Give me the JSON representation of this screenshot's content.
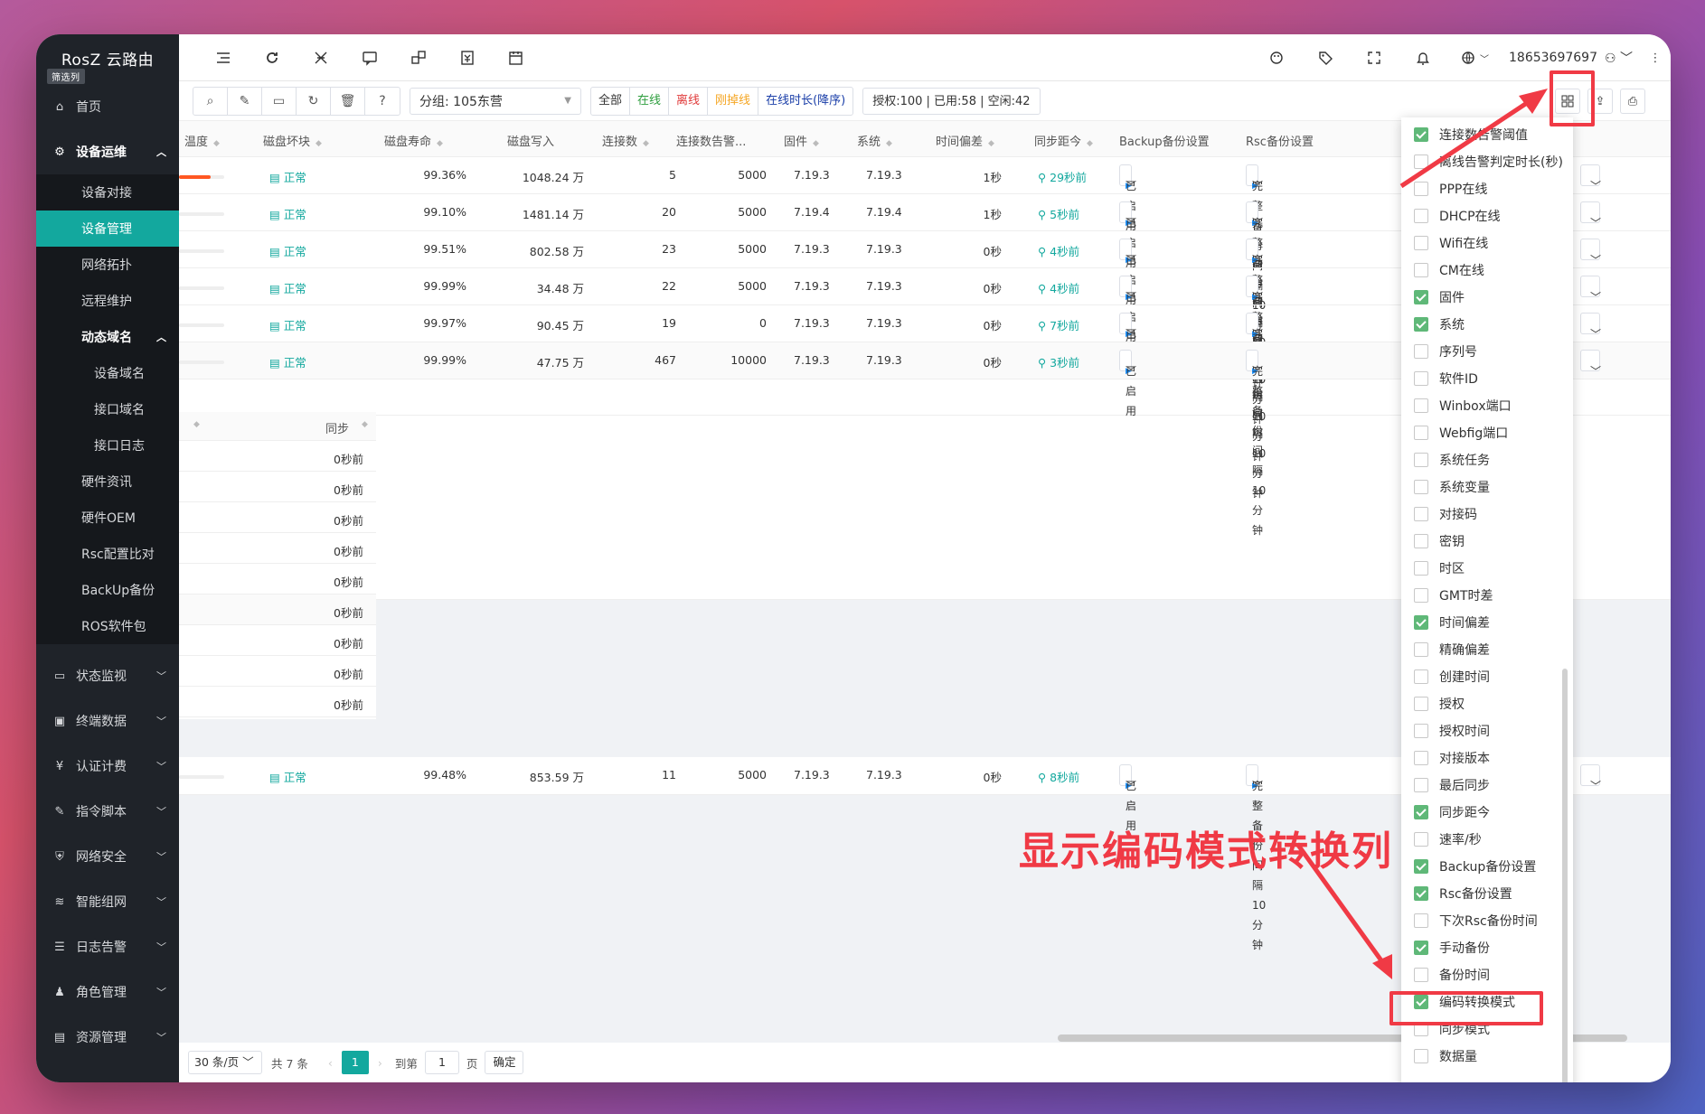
{
  "brand": {
    "name": "RosZ 云路由",
    "tag": "筛选列"
  },
  "nav": {
    "home": "首页",
    "ops": "设备运维",
    "ops_items": [
      "设备对接",
      "设备管理",
      "网络拓扑",
      "远程维护"
    ],
    "ddns": "动态域名",
    "ddns_items": [
      "设备域名",
      "接口域名",
      "接口日志"
    ],
    "more_items": [
      "硬件资讯",
      "硬件OEM",
      "Rsc配置比对",
      "BackUp备份",
      "ROS软件包"
    ],
    "groups": [
      "状态监视",
      "终端数据",
      "认证计费",
      "指令脚本",
      "网络安全",
      "智能组网",
      "日志告警",
      "角色管理",
      "资源管理"
    ]
  },
  "topbar": {
    "user": "18653697697"
  },
  "toolbar": {
    "group_select": "分组: 105东营",
    "filters": [
      {
        "label": "全部",
        "color": "#333333"
      },
      {
        "label": "在线",
        "color": "#2e9e3e"
      },
      {
        "label": "离线",
        "color": "#e03b3b"
      },
      {
        "label": "刚掉线",
        "color": "#f5a623"
      },
      {
        "label": "在线时长(降序)",
        "color": "#1a3ea8"
      }
    ],
    "stats": "授权:100 | 已用:58 | 空闲:42"
  },
  "table": {
    "headers": [
      "温度",
      "磁盘坏块",
      "磁盘寿命",
      "磁盘写入",
      "连接数",
      "连接数告警...",
      "固件",
      "系统",
      "时间偏差",
      "同步距今",
      "Backup备份设置",
      "Rsc备份设置"
    ],
    "rows": [
      {
        "bad": "正常",
        "life": "99.36%",
        "write": "1048.24 万",
        "conn": "5",
        "alarm": "5000",
        "fw": "7.19.3",
        "sys": "7.19.3",
        "skew": "1秒",
        "sync": "29秒前",
        "backup": "已启用",
        "rsc": "完整备份 间隔10分钟",
        "temp": 0.7
      },
      {
        "bad": "正常",
        "life": "99.10%",
        "write": "1481.14 万",
        "conn": "20",
        "alarm": "5000",
        "fw": "7.19.4",
        "sys": "7.19.4",
        "skew": "1秒",
        "sync": "5秒前",
        "backup": "已启用",
        "rsc": "完整备份 间隔10分钟",
        "temp": 0
      },
      {
        "bad": "正常",
        "life": "99.51%",
        "write": "802.58 万",
        "conn": "23",
        "alarm": "5000",
        "fw": "7.19.3",
        "sys": "7.19.3",
        "skew": "0秒",
        "sync": "4秒前",
        "backup": "已启用",
        "rsc": "完整备份 间隔10分钟",
        "temp": 0
      },
      {
        "bad": "正常",
        "life": "99.99%",
        "write": "34.48 万",
        "conn": "22",
        "alarm": "5000",
        "fw": "7.19.3",
        "sys": "7.19.3",
        "skew": "0秒",
        "sync": "4秒前",
        "backup": "已启用",
        "rsc": "完整备份 间隔10分钟",
        "temp": 0
      },
      {
        "bad": "正常",
        "life": "99.97%",
        "write": "90.45 万",
        "conn": "19",
        "alarm": "0",
        "fw": "7.19.3",
        "sys": "7.19.3",
        "skew": "0秒",
        "sync": "7秒前",
        "backup": "已启用",
        "rsc": "完整备份 间隔10分钟",
        "temp": 0
      },
      {
        "bad": "正常",
        "life": "99.99%",
        "write": "47.75 万",
        "conn": "467",
        "alarm": "10000",
        "fw": "7.19.3",
        "sys": "7.19.3",
        "skew": "0秒",
        "sync": "3秒前",
        "backup": "已启用",
        "rsc": "完整备份 间隔10分钟",
        "temp": 0
      }
    ],
    "lower_row": {
      "bad": "正常",
      "life": "99.48%",
      "write": "853.59 万",
      "conn": "11",
      "alarm": "5000",
      "fw": "7.19.3",
      "sys": "7.19.3",
      "skew": "0秒",
      "sync": "8秒前",
      "backup": "已启用",
      "rsc": "完整备份 间隔10分钟",
      "temp": 0
    }
  },
  "fixed": {
    "header": "同步",
    "rows": [
      "0秒前",
      "0秒前",
      "0秒前",
      "0秒前",
      "0秒前",
      "0秒前",
      "0秒前",
      "0秒前",
      "0秒前"
    ]
  },
  "pager": {
    "page_size": "30 条/页",
    "total": "共 7 条",
    "current": "1",
    "goto": "到第",
    "page_input": "1",
    "page_unit": "页",
    "confirm": "确定"
  },
  "columns_panel": [
    {
      "label": "连接数告警阈值",
      "checked": true
    },
    {
      "label": "离线告警判定时长(秒)",
      "checked": false
    },
    {
      "label": "PPP在线",
      "checked": false
    },
    {
      "label": "DHCP在线",
      "checked": false
    },
    {
      "label": "Wifi在线",
      "checked": false
    },
    {
      "label": "CM在线",
      "checked": false
    },
    {
      "label": "固件",
      "checked": true
    },
    {
      "label": "系统",
      "checked": true
    },
    {
      "label": "序列号",
      "checked": false
    },
    {
      "label": "软件ID",
      "checked": false
    },
    {
      "label": "Winbox端口",
      "checked": false
    },
    {
      "label": "Webfig端口",
      "checked": false
    },
    {
      "label": "系统任务",
      "checked": false
    },
    {
      "label": "系统变量",
      "checked": false
    },
    {
      "label": "对接码",
      "checked": false
    },
    {
      "label": "密钥",
      "checked": false
    },
    {
      "label": "时区",
      "checked": false
    },
    {
      "label": "GMT时差",
      "checked": false
    },
    {
      "label": "时间偏差",
      "checked": true
    },
    {
      "label": "精确偏差",
      "checked": false
    },
    {
      "label": "创建时间",
      "checked": false
    },
    {
      "label": "授权",
      "checked": false
    },
    {
      "label": "授权时间",
      "checked": false
    },
    {
      "label": "对接版本",
      "checked": false
    },
    {
      "label": "最后同步",
      "checked": false
    },
    {
      "label": "同步距今",
      "checked": true
    },
    {
      "label": "速率/秒",
      "checked": false
    },
    {
      "label": "Backup备份设置",
      "checked": true
    },
    {
      "label": "Rsc备份设置",
      "checked": true
    },
    {
      "label": "下次Rsc备份时间",
      "checked": false
    },
    {
      "label": "手动备份",
      "checked": true
    },
    {
      "label": "备份时间",
      "checked": false
    },
    {
      "label": "编码转换模式",
      "checked": true
    },
    {
      "label": "同步模式",
      "checked": false
    },
    {
      "label": "数据量",
      "checked": false
    }
  ],
  "annotation": "显示编码模式转换列",
  "colors": {
    "accent": "#13a89e",
    "annotation": "#f03a45",
    "checked": "#5fb878"
  }
}
